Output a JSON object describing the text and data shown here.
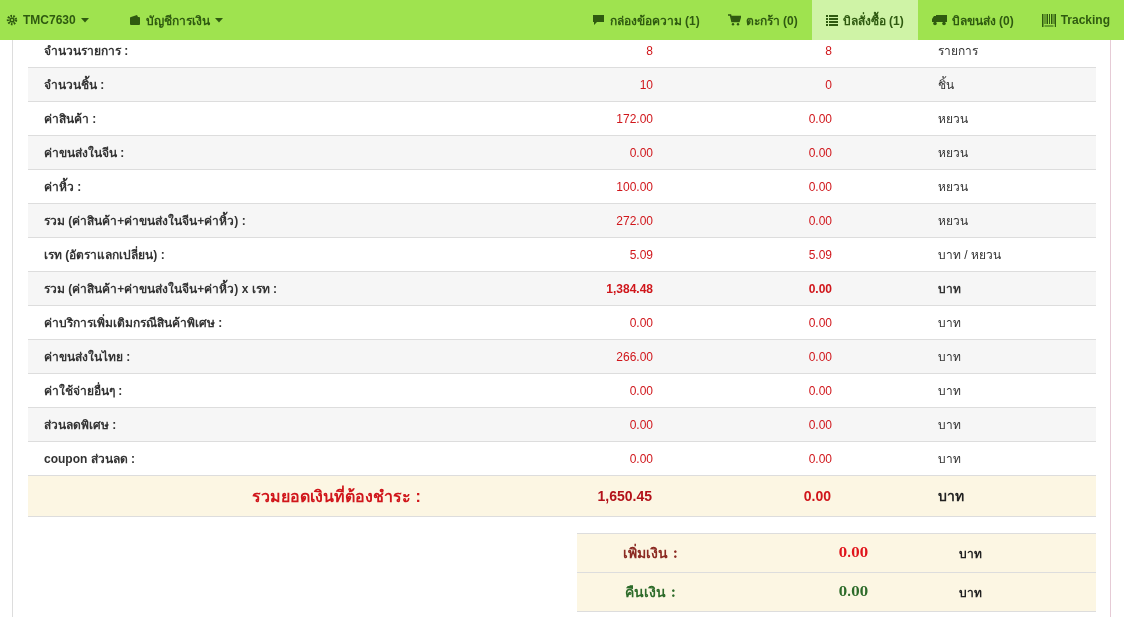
{
  "navbar": {
    "left": [
      {
        "label": "TMC7630",
        "kind": "gear"
      },
      {
        "label": "บัญชีการเงิน",
        "kind": "wallet"
      }
    ],
    "right": [
      {
        "label": "กล่องข้อความ (1)",
        "kind": "comment",
        "selected": false
      },
      {
        "label": "ตะกร้า (0)",
        "kind": "cart",
        "selected": false
      },
      {
        "label": "บิลสั่งซื้อ (1)",
        "kind": "list",
        "selected": true
      },
      {
        "label": "บิลขนส่ง (0)",
        "kind": "truck",
        "selected": false
      },
      {
        "label": "Tracking",
        "kind": "barcode",
        "selected": false
      }
    ]
  },
  "summary": {
    "rows": [
      {
        "label": "จำนวนรายการ :",
        "value_1": "8",
        "value_2": "8",
        "unit": "รายการ",
        "kind": "normal"
      },
      {
        "label": "จำนวนชิ้น :",
        "value_1": "10",
        "value_2": "0",
        "unit": "ชิ้น",
        "kind": "normal"
      },
      {
        "label": "ค่าสินค้า :",
        "value_1": "172.00",
        "value_2": "0.00",
        "unit": "หยวน",
        "kind": "normal"
      },
      {
        "label": "ค่าขนส่งในจีน :",
        "value_1": "0.00",
        "value_2": "0.00",
        "unit": "หยวน",
        "kind": "normal"
      },
      {
        "label": "ค่าหิ้ว :",
        "value_1": "100.00",
        "value_2": "0.00",
        "unit": "หยวน",
        "kind": "normal"
      },
      {
        "label": "รวม (ค่าสินค้า+ค่าขนส่งในจีน+ค่าหิ้ว) :",
        "value_1": "272.00",
        "value_2": "0.00",
        "unit": "หยวน",
        "kind": "normal"
      },
      {
        "label": "เรท (อัตราแลกเปลี่ยน) :",
        "value_1": "5.09",
        "value_2": "5.09",
        "unit": "บาท / หยวน",
        "kind": "normal"
      },
      {
        "label": "รวม (ค่าสินค้า+ค่าขนส่งในจีน+ค่าหิ้ว) x เรท :",
        "value_1": "1,384.48",
        "value_2": "0.00",
        "unit": "บาท",
        "kind": "bold"
      },
      {
        "label": "ค่าบริการเพิ่มเติมกรณีสินค้าพิเศษ :",
        "value_1": "0.00",
        "value_2": "0.00",
        "unit": "บาท",
        "kind": "normal"
      },
      {
        "label": "ค่าขนส่งในไทย :",
        "value_1": "266.00",
        "value_2": "0.00",
        "unit": "บาท",
        "kind": "normal"
      },
      {
        "label": "ค่าใช้จ่ายอื่นๆ :",
        "value_1": "0.00",
        "value_2": "0.00",
        "unit": "บาท",
        "kind": "normal"
      },
      {
        "label": "ส่วนลดพิเศษ :",
        "value_1": "0.00",
        "value_2": "0.00",
        "unit": "บาท",
        "kind": "normal"
      },
      {
        "label": "coupon ส่วนลด :",
        "value_1": "0.00",
        "value_2": "0.00",
        "unit": "บาท",
        "kind": "normal"
      }
    ],
    "total": {
      "label": "รวมยอดเงินที่ต้องชำระ :",
      "value_1": "1,650.45",
      "value_2": "0.00",
      "unit": "บาท"
    }
  },
  "adjustments": [
    {
      "label": "เพิ่มเงิน :",
      "value": "0.00",
      "unit": "บาท",
      "kind": "add"
    },
    {
      "label": "คืนเงิน :",
      "value": "0.00",
      "unit": "บาท",
      "kind": "refund"
    }
  ]
}
